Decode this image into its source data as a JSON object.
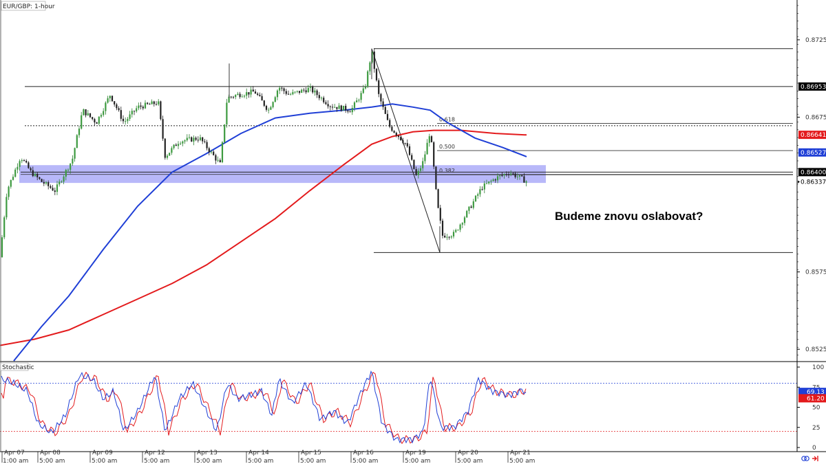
{
  "chart_data": {
    "type": "candlestick",
    "title": "EUR/GBP: 1-hour",
    "annotation": "Budeme znovu oslabovat?",
    "price_axis": {
      "ylim": [
        0.8518,
        0.8749
      ],
      "ticks": [
        "0.87255",
        "0.86755",
        "0.85755",
        "0.85255"
      ],
      "tick_values": [
        0.87255,
        0.86755,
        0.85755,
        0.85255
      ]
    },
    "price_labels": [
      {
        "text": "0.86953",
        "value": 0.86953,
        "color": "#000000"
      },
      {
        "text": "0.86641",
        "value": 0.86641,
        "color": "#e31a1c"
      },
      {
        "text": "0.86527",
        "value": 0.86527,
        "color": "#1f3fd6"
      },
      {
        "text": "0.86400",
        "value": 0.864,
        "color": "#000000"
      },
      {
        "text": "0.86337",
        "value": 0.86337,
        "color": "#ffffff"
      }
    ],
    "horizontal_lines": [
      {
        "value": 0.87198,
        "style": "solid"
      },
      {
        "value": 0.86953,
        "style": "solid"
      },
      {
        "value": 0.867,
        "style": "dotted"
      },
      {
        "value": 0.864,
        "style": "solid"
      },
      {
        "value": 0.8588,
        "style": "solid"
      }
    ],
    "support_zone": {
      "from": 0.8633,
      "to": 0.86445,
      "color": "#8c8cf5"
    },
    "fibonacci": {
      "high": 0.87198,
      "low": 0.8588,
      "levels": [
        {
          "label": "0.618",
          "value": 0.86715
        },
        {
          "label": "0.500",
          "value": 0.86539
        },
        {
          "label": "0.382",
          "value": 0.86383
        }
      ]
    },
    "x_labels": [
      "Apr 07",
      "1:00 am",
      "5:00 am",
      "Apr 08",
      "5:00 am",
      "Apr 09",
      "5:00 am",
      "Apr 12",
      "5:00 am",
      "Apr 13",
      "5:00 am",
      "Apr 14",
      "5:00 am",
      "Apr 15",
      "5:00 am",
      "Apr 16",
      "5:00 am",
      "Apr 19",
      "5:00 am",
      "Apr 20",
      "5:00 am",
      "Apr 21",
      "5:00 am"
    ],
    "ma_blue_color": "#1f3fd6",
    "ma_red_color": "#e31a1c",
    "stochastic": {
      "title": "Stochastic",
      "ticks": [
        "100",
        "75",
        "50",
        "25",
        "0"
      ],
      "tick_values": [
        100,
        75,
        50,
        25,
        0
      ],
      "overbought": 80,
      "oversold": 20,
      "values": [
        {
          "text": "69.13",
          "value": 69.13,
          "color": "#1f3fd6"
        },
        {
          "text": "61.20",
          "value": 61.2,
          "color": "#e31a1c"
        }
      ]
    }
  }
}
